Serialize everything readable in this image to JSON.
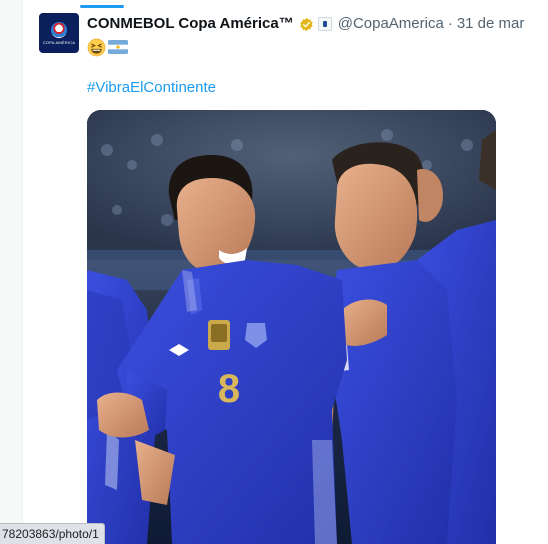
{
  "tweet": {
    "author": {
      "display_name": "CONMEBOL Copa América™",
      "handle": "@CopaAmerica",
      "avatar_text": "COPA AMÉRICA"
    },
    "separator": "·",
    "date": "31 de mar",
    "emojis": [
      "grinning-squinting-face",
      "argentina-flag"
    ],
    "hashtag": "#VibraElContinente",
    "media": {
      "kind": "photo",
      "jersey_number": "8"
    }
  },
  "browser": {
    "status_url": "78203863/photo/1"
  },
  "colors": {
    "link": "#1d9bf0",
    "secondary_text": "#536471",
    "verified_gold": "#e2b719",
    "top_tab": "#1d9bf0",
    "jersey_blue": "#2d3fd1"
  }
}
